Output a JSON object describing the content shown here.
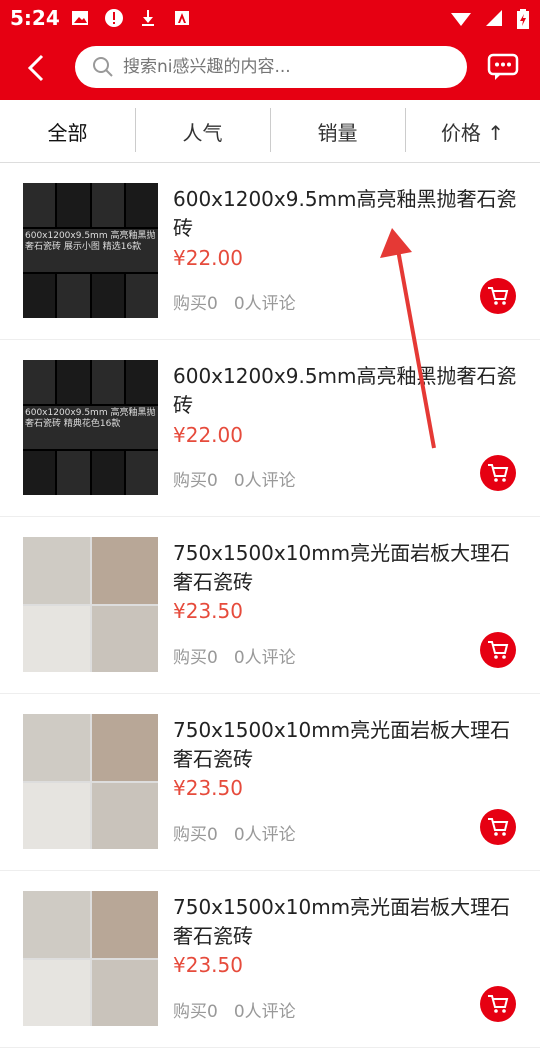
{
  "status": {
    "time": "5:24"
  },
  "search": {
    "placeholder": "搜索ni感兴趣的内容..."
  },
  "tabs": [
    {
      "label": "全部"
    },
    {
      "label": "人气"
    },
    {
      "label": "销量"
    },
    {
      "label": "价格 ↑"
    }
  ],
  "products": [
    {
      "title": "600x1200x9.5mm高亮釉黑抛奢石瓷砖",
      "price": "¥22.00",
      "sold": "购买0",
      "reviews": "0人评论",
      "thumb_caption": "600x1200x9.5mm 高亮釉黑抛奢石瓷砖 展示小图 精选16款"
    },
    {
      "title": "600x1200x9.5mm高亮釉黑抛奢石瓷砖",
      "price": "¥22.00",
      "sold": "购买0",
      "reviews": "0人评论",
      "thumb_caption": "600x1200x9.5mm 高亮釉黑抛奢石瓷砖 精典花色16款"
    },
    {
      "title": "750x1500x10mm亮光面岩板大理石奢石瓷砖",
      "price": "¥23.50",
      "sold": "购买0",
      "reviews": "0人评论"
    },
    {
      "title": "750x1500x10mm亮光面岩板大理石奢石瓷砖",
      "price": "¥23.50",
      "sold": "购买0",
      "reviews": "0人评论"
    },
    {
      "title": "750x1500x10mm亮光面岩板大理石奢石瓷砖",
      "price": "¥23.50",
      "sold": "购买0",
      "reviews": "0人评论"
    }
  ],
  "colors": {
    "brand": "#e60012",
    "price": "#e64b3c"
  }
}
